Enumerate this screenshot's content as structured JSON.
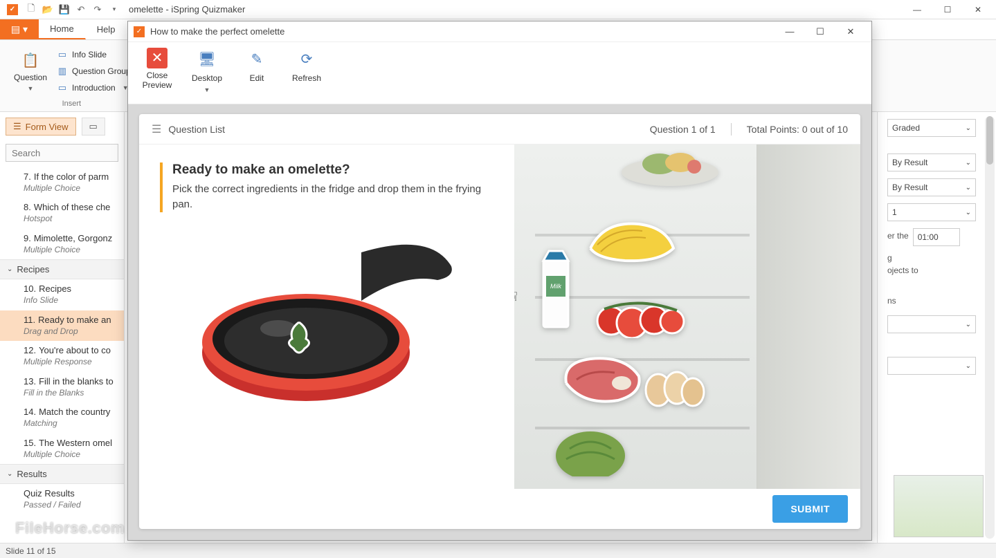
{
  "app": {
    "title": "omelette - iSpring Quizmaker"
  },
  "tabs": {
    "home": "Home",
    "help": "Help"
  },
  "ribbon": {
    "question": "Question",
    "info_slide": "Info Slide",
    "question_group": "Question Group",
    "introduction": "Introduction",
    "insert_label": "Insert"
  },
  "left": {
    "form_view": "Form View",
    "search_placeholder": "Search",
    "group_recipes": "Recipes",
    "group_results": "Results",
    "items": {
      "i7": {
        "num": "7.",
        "title": "If the color of parm",
        "sub": "Multiple Choice"
      },
      "i8": {
        "num": "8.",
        "title": "Which of these che",
        "sub": "Hotspot"
      },
      "i9": {
        "num": "9.",
        "title": "Mimolette, Gorgonz",
        "sub": "Multiple Choice"
      },
      "i10": {
        "num": "10.",
        "title": "Recipes",
        "sub": "Info Slide"
      },
      "i11": {
        "num": "11.",
        "title": "Ready to make an",
        "sub": "Drag and Drop"
      },
      "i12": {
        "num": "12.",
        "title": "You're about to co",
        "sub": "Multiple Response"
      },
      "i13": {
        "num": "13.",
        "title": "Fill in the blanks to",
        "sub": "Fill in the Blanks"
      },
      "i14": {
        "num": "14.",
        "title": "Match the country",
        "sub": "Matching"
      },
      "i15": {
        "num": "15.",
        "title": "The Western omel",
        "sub": "Multiple Choice"
      },
      "results": {
        "title": "Quiz Results",
        "sub": "Passed / Failed"
      }
    }
  },
  "status": {
    "text": "Slide 11 of 15"
  },
  "right": {
    "graded": "Graded",
    "by_result1": "By Result",
    "by_result2": "By Result",
    "one": "1",
    "er_the": "er the",
    "time": "01:00",
    "g": "g",
    "ojects_to": "ojects to",
    "ns": "ns"
  },
  "preview": {
    "title": "How to make the perfect omelette",
    "close_preview": "Close Preview",
    "desktop": "Desktop",
    "edit": "Edit",
    "refresh": "Refresh",
    "question_list": "Question List",
    "q_counter": "Question 1 of 1",
    "points": "Total Points: 0 out of 10",
    "q_title": "Ready to make an omelette?",
    "q_desc": "Pick the correct ingredients in the fridge and drop them in the frying pan.",
    "submit": "SUBMIT"
  },
  "watermark": "FileHorse.com"
}
